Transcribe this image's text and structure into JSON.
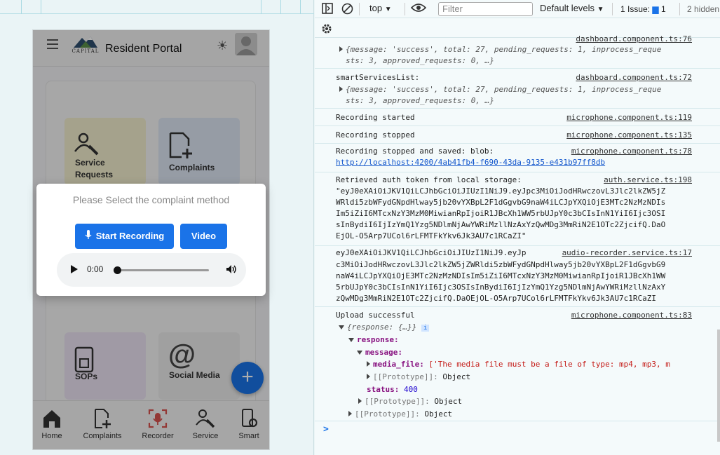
{
  "app": {
    "title": "Resident Portal",
    "logo_text": "CAPITAL",
    "cards": [
      {
        "label": "Service Requests",
        "icon": "service-icon",
        "color": "#f3efcf"
      },
      {
        "label": "Complaints",
        "icon": "complaints-icon",
        "color": "#dde6f4"
      },
      {
        "label": "SOPs",
        "icon": "sops-icon",
        "color": "#ece4f4"
      },
      {
        "label": "Social Media",
        "icon": "at-icon",
        "color": "#ececec"
      }
    ],
    "fab_label": "+",
    "nav": [
      {
        "label": "Home",
        "icon": "home-icon"
      },
      {
        "label": "Complaints",
        "icon": "complaints-icon"
      },
      {
        "label": "Recorder",
        "icon": "recorder-icon",
        "color": "#d9534f"
      },
      {
        "label": "Service",
        "icon": "service-icon"
      },
      {
        "label": "Smart",
        "icon": "smart-icon"
      }
    ]
  },
  "modal": {
    "title": "Please Select the complaint method",
    "start_recording": "Start Recording",
    "video": "Video",
    "player_time": "0:00"
  },
  "devtools": {
    "context": "top",
    "filter_placeholder": "Filter",
    "levels": "Default levels",
    "issues_label": "1 Issue:",
    "issues_count": "1",
    "hidden": "2 hidden",
    "logs": [
      {
        "msg": "",
        "obj": "{message: 'success', total: 27, pending_requests: 1, inprocess_reque\nsts: 3, approved_requests: 0, …}",
        "src": "dashboard.component.ts:76"
      },
      {
        "msg": "smartServicesList:",
        "obj": "{message: 'success', total: 27, pending_requests: 1, inprocess_reque\nsts: 3, approved_requests: 0, …}",
        "src": "dashboard.component.ts:72"
      },
      {
        "msg": "Recording started",
        "src": "microphone.component.ts:119"
      },
      {
        "msg": "Recording stopped",
        "src": "microphone.component.ts:135"
      },
      {
        "msg": "Recording stopped and saved: blob:",
        "link": "http://localhost:4200/4ab41fb4-f690-43da-9135-e431b97ff8db",
        "src": "microphone.component.ts:78"
      },
      {
        "msg": "Retrieved auth token from local storage:",
        "token": "\"eyJ0eXAiOiJKV1QiLCJhbGciOiJIUzI1NiJ9.eyJpc3MiOiJodHRwczovL3Jlc2lkZW5jZ\nWRldi5zbWFydGNpdHlway5jb20vYXBpL2F1dGgvbG9naW4iLCJpYXQiOjE3MTc2NzMzNDIs\nIm5iZiI6MTcxNzY3MzM0MiwianRpIjoiR1JBcXh1WW5rbUJpY0c3bCIsInN1YiI6Ijc3OSI\nsInBydiI6IjIzYmQ1Yzg5NDlmNjAwYWRiMzllNzAxYzQwMDg3MmRiN2E1OTc2ZjcifQ.DaO\nEjOL-O5Arp7UCol6rLFMTFkYkv6Jk3AU7c1RCaZI\"",
        "src": "auth.service.ts:198"
      },
      {
        "msg": "eyJ0eXAiOiJKV1QiLCJhbGciOiJIUzI1NiJ9.eyJp",
        "token": "c3MiOiJodHRwczovL3Jlc2lkZW5jZWRldi5zbWFydGNpdHlway5jb20vYXBpL2F1dGgvbG9\nnaW4iLCJpYXQiOjE3MTc2NzMzNDIsIm5iZiI6MTcxNzY3MzM0MiwianRpIjoiR1JBcXh1WW\n5rbUJpY0c3bCIsInN1YiI6Ijc3OSIsInBydiI6IjIzYmQ1Yzg5NDlmNjAwYWRiMzllNzAxY\nzQwMDg3MmRiN2E1OTc2ZjcifQ.DaOEjOL-O5Arp7UCol6rLFMTFkYkv6Jk3AU7c1RCaZI",
        "src": "audio-recorder.service.ts:17"
      },
      {
        "msg": "Upload successful",
        "src": "microphone.component.ts:83"
      }
    ],
    "tree": {
      "root": "{response: {…}}",
      "response_key": "response:",
      "message_key": "message:",
      "media_file_key": "media_file:",
      "media_file_val": "['The media file must be a file of type: mp4, mp3, m",
      "proto": "[[Prototype]]:",
      "object": "Object",
      "status_key": "status:",
      "status_val": "400"
    },
    "prompt": ">"
  }
}
